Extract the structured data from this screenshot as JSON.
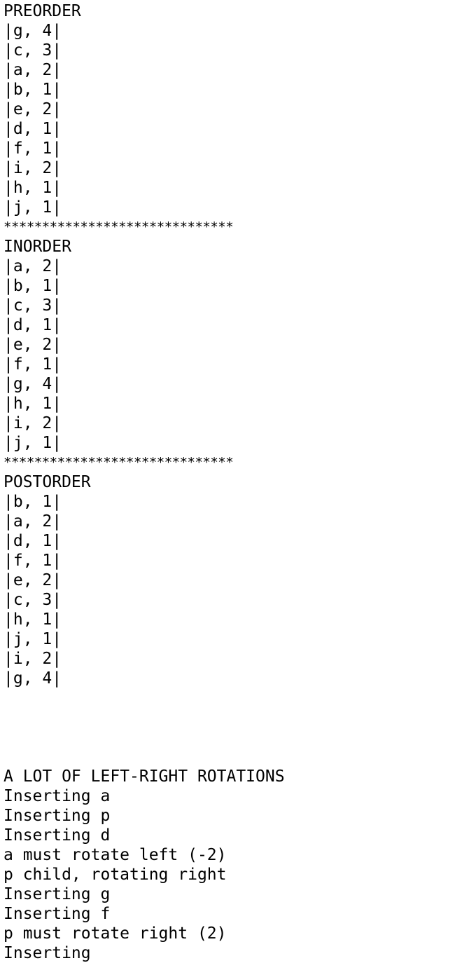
{
  "colors": {
    "background": "#ffffff",
    "text": "#000000"
  },
  "lines": [
    "PREORDER",
    "|g, 4|",
    "|c, 3|",
    "|a, 2|",
    "|b, 1|",
    "|e, 2|",
    "|d, 1|",
    "|f, 1|",
    "|i, 2|",
    "|h, 1|",
    "|j, 1|",
    "******************************",
    "INORDER",
    "|a, 2|",
    "|b, 1|",
    "|c, 3|",
    "|d, 1|",
    "|e, 2|",
    "|f, 1|",
    "|g, 4|",
    "|h, 1|",
    "|i, 2|",
    "|j, 1|",
    "******************************",
    "POSTORDER",
    "|b, 1|",
    "|a, 2|",
    "|d, 1|",
    "|f, 1|",
    "|e, 2|",
    "|c, 3|",
    "|h, 1|",
    "|j, 1|",
    "|i, 2|",
    "|g, 4|",
    "",
    "",
    "",
    "",
    "A LOT OF LEFT-RIGHT ROTATIONS",
    "Inserting a",
    "Inserting p",
    "Inserting d",
    "a must rotate left (-2)",
    "p child, rotating right",
    "Inserting g",
    "Inserting f",
    "p must rotate right (2)",
    "Inserting"
  ]
}
